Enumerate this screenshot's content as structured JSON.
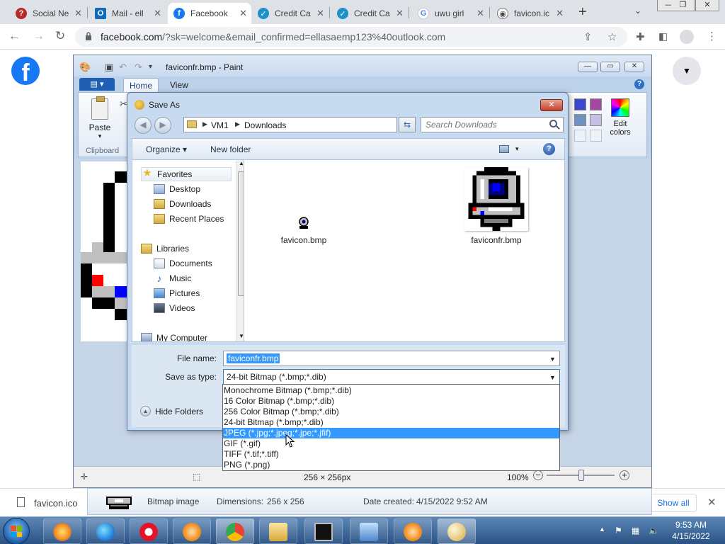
{
  "browser": {
    "tabs": [
      {
        "title": "Social Ne",
        "icon": "quora-icon",
        "color": "#b92b27"
      },
      {
        "title": "Mail - ell",
        "icon": "outlook-icon",
        "color": "#0f6cbd"
      },
      {
        "title": "Facebook",
        "icon": "facebook-icon",
        "color": "#1877f2",
        "active": true
      },
      {
        "title": "Credit Ca",
        "icon": "shield-check-icon",
        "color": "#1e90c8"
      },
      {
        "title": "Credit Ca",
        "icon": "shield-check-icon",
        "color": "#1e90c8"
      },
      {
        "title": "uwu girl",
        "icon": "google-icon",
        "color": "#4285f4"
      },
      {
        "title": "favicon.ic",
        "icon": "webcam-icon",
        "color": "#555555"
      }
    ],
    "url_host": "facebook.com",
    "url_rest": "/?sk=welcome&email_confirmed=ellasaemp123%40outlook.com",
    "new_tab": "+"
  },
  "facebook": {
    "logo": "f",
    "menu": "▼"
  },
  "paint": {
    "title": "faviconfr.bmp - Paint",
    "tabs": [
      "Home",
      "View"
    ],
    "paste_label": "Paste",
    "clipboard_label": "Clipboard",
    "edit_colors": "Edit colors",
    "status_dims": "256 × 256px",
    "zoom": "100%"
  },
  "saveas": {
    "title": "Save As",
    "breadcrumb": [
      "VM1",
      "Downloads"
    ],
    "search_placeholder": "Search Downloads",
    "organize": "Organize",
    "new_folder": "New folder",
    "nav": {
      "favorites": "Favorites",
      "desktop": "Desktop",
      "downloads": "Downloads",
      "recent": "Recent Places",
      "libraries": "Libraries",
      "documents": "Documents",
      "music": "Music",
      "pictures": "Pictures",
      "videos": "Videos",
      "computer": "My Computer"
    },
    "files": [
      "favicon.bmp",
      "faviconfr.bmp"
    ],
    "file_name_label": "File name:",
    "file_name": "faviconfr.bmp",
    "save_type_label": "Save as type:",
    "save_type": "24-bit Bitmap (*.bmp;*.dib)",
    "hide_folders": "Hide Folders",
    "type_options": [
      "Monochrome Bitmap (*.bmp;*.dib)",
      "16 Color Bitmap (*.bmp;*.dib)",
      "256 Color Bitmap (*.bmp;*.dib)",
      "24-bit Bitmap (*.bmp;*.dib)",
      "JPEG (*.jpg;*.jpeg;*.jpe;*.jfif)",
      "GIF (*.gif)",
      "TIFF (*.tif;*.tiff)",
      "PNG (*.png)"
    ],
    "highlighted_option": 4
  },
  "details": {
    "type": "Bitmap image",
    "dims_label": "Dimensions:",
    "dims": "256 x 256",
    "created_label": "Date created:",
    "created": "4/15/2022 9:52 AM"
  },
  "downloads": {
    "file": "favicon.ico",
    "show_all": "Show all"
  },
  "taskbar": {
    "time": "9:53 AM",
    "date": "4/15/2022"
  }
}
